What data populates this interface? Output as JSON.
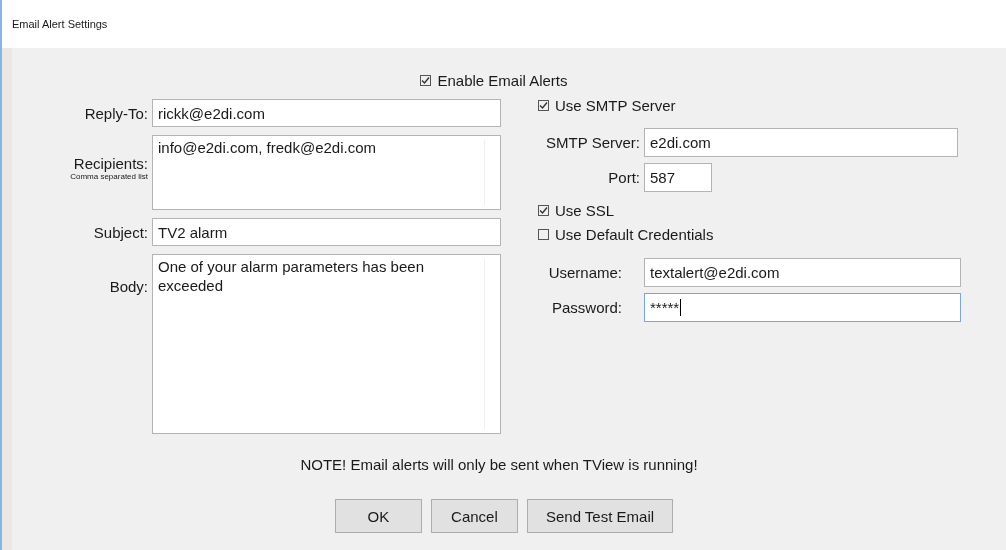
{
  "window": {
    "title": "Email Alert Settings"
  },
  "enable_alerts": {
    "label": "Enable Email Alerts",
    "checked": true
  },
  "left_fields": [
    {
      "kind": "line",
      "label": "Reply-To:",
      "value": "rickk@e2di.com"
    },
    {
      "kind": "area",
      "label": "Recipients:",
      "hint": "Comma separated list",
      "value": "info@e2di.com, fredk@e2di.com"
    },
    {
      "kind": "line",
      "label": "Subject:",
      "value": "TV2 alarm"
    },
    {
      "kind": "body",
      "label": "Body:",
      "value": "One of your alarm parameters has been exceeded"
    }
  ],
  "right_items": [
    {
      "kind": "check",
      "label": "Use SMTP Server",
      "checked": true
    },
    {
      "kind": "field",
      "label": "SMTP Server:",
      "value": "e2di.com"
    },
    {
      "kind": "short_field",
      "label": "Port:",
      "value": "587"
    },
    {
      "kind": "check",
      "label": "Use SSL",
      "checked": true
    },
    {
      "kind": "check",
      "label": "Use Default Credentials",
      "checked": false
    },
    {
      "kind": "cred",
      "label": "Username:",
      "value": "textalert@e2di.com",
      "focused": false
    },
    {
      "kind": "cred",
      "label": "Password:",
      "value": "*****",
      "focused": true
    }
  ],
  "note": "NOTE!  Email alerts will only be sent when TView is running!",
  "buttons": [
    "OK",
    "Cancel",
    "Send Test Email"
  ]
}
